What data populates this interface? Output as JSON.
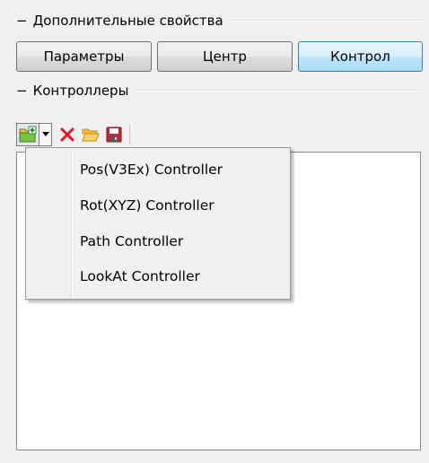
{
  "groups": {
    "additional_properties": "Дополнительные свойства",
    "controllers": "Контроллеры"
  },
  "tabs": [
    {
      "label": "Параметры",
      "active": false
    },
    {
      "label": "Центр",
      "active": false
    },
    {
      "label": "Контрол",
      "active": true
    }
  ],
  "toolbar": {
    "buttons": [
      {
        "icon": "add-controller-icon",
        "pressed": true
      },
      {
        "icon": "chevron-down-icon"
      },
      {
        "icon": "delete-icon",
        "color": "#e81123"
      },
      {
        "icon": "open-folder-icon",
        "color": "#f5b940"
      },
      {
        "icon": "save-icon",
        "color": "#c9272d"
      }
    ]
  },
  "menu": {
    "items": [
      "Pos(V3Ex) Controller",
      "Rot(XYZ) Controller",
      "Path Controller",
      "LookAt Controller"
    ]
  },
  "colors": {
    "background": "#f0f0f0",
    "active_tab_border": "#3c7fb1",
    "delete_red": "#e81123",
    "folder_yellow": "#f5b940"
  }
}
